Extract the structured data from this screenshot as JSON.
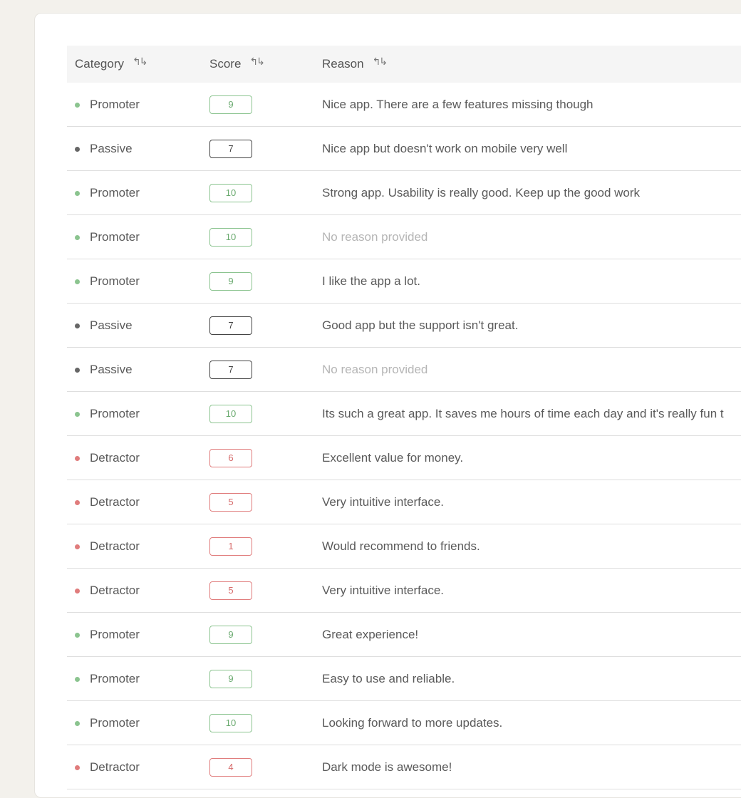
{
  "colors": {
    "promoter": "#8bc48f",
    "passive": "#666666",
    "detractor": "#e07c7c"
  },
  "table": {
    "headers": [
      {
        "label": "Category",
        "sort_icon": "sort-arrows-icon"
      },
      {
        "label": "Score",
        "sort_icon": "sort-arrows-icon"
      },
      {
        "label": "Reason",
        "sort_icon": "sort-arrows-icon"
      }
    ],
    "rows": [
      {
        "category": "Promoter",
        "type": "promoter",
        "score": "9",
        "reason": "Nice app. There are a few features missing though"
      },
      {
        "category": "Passive",
        "type": "passive",
        "score": "7",
        "reason": "Nice app but doesn't work on mobile very well"
      },
      {
        "category": "Promoter",
        "type": "promoter",
        "score": "10",
        "reason": "Strong app. Usability is really good. Keep up the good work"
      },
      {
        "category": "Promoter",
        "type": "promoter",
        "score": "10",
        "reason": "No reason provided",
        "empty": true
      },
      {
        "category": "Promoter",
        "type": "promoter",
        "score": "9",
        "reason": "I like the app a lot."
      },
      {
        "category": "Passive",
        "type": "passive",
        "score": "7",
        "reason": "Good app but the support isn't great."
      },
      {
        "category": "Passive",
        "type": "passive",
        "score": "7",
        "reason": "No reason provided",
        "empty": true
      },
      {
        "category": "Promoter",
        "type": "promoter",
        "score": "10",
        "reason": "Its such a great app. It saves me hours of time each day and it's really fun t"
      },
      {
        "category": "Detractor",
        "type": "detractor",
        "score": "6",
        "reason": "Excellent value for money."
      },
      {
        "category": "Detractor",
        "type": "detractor",
        "score": "5",
        "reason": "Very intuitive interface."
      },
      {
        "category": "Detractor",
        "type": "detractor",
        "score": "1",
        "reason": "Would recommend to friends."
      },
      {
        "category": "Detractor",
        "type": "detractor",
        "score": "5",
        "reason": "Very intuitive interface."
      },
      {
        "category": "Promoter",
        "type": "promoter",
        "score": "9",
        "reason": "Great experience!"
      },
      {
        "category": "Promoter",
        "type": "promoter",
        "score": "9",
        "reason": "Easy to use and reliable."
      },
      {
        "category": "Promoter",
        "type": "promoter",
        "score": "10",
        "reason": "Looking forward to more updates."
      },
      {
        "category": "Detractor",
        "type": "detractor",
        "score": "4",
        "reason": "Dark mode is awesome!"
      }
    ]
  }
}
